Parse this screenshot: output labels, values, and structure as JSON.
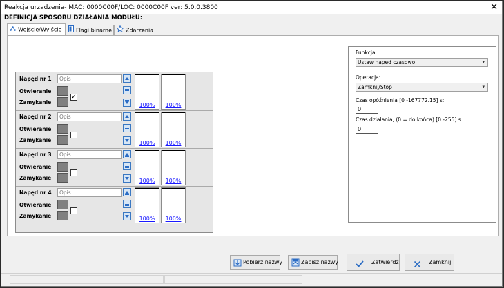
{
  "window": {
    "title": "Reakcja urzadzenia- MAC: 0000C00F/LOC: 0000C00F ver: 5.0.0.3800",
    "close_icon": "close-icon"
  },
  "heading": "DEFINICJA SPOSOBU DZIAŁANIA MODUŁU:",
  "tabs": [
    {
      "label": "Wejście/Wyjście",
      "icon": "network-icon",
      "active": true
    },
    {
      "label": "Flagi binarne",
      "icon": "flag-panel-icon",
      "active": false
    },
    {
      "label": "Zdarzenia",
      "icon": "star-icon",
      "active": false
    }
  ],
  "drives": [
    {
      "name": "Napęd nr 1",
      "opis": "Opis",
      "otwieranie": "Otwieranie",
      "zamykanie": "Zamykanie",
      "checked": true,
      "gauge1": "100%",
      "gauge2": "100%"
    },
    {
      "name": "Napęd nr 2",
      "opis": "Opis",
      "otwieranie": "Otwieranie",
      "zamykanie": "Zamykanie",
      "checked": false,
      "gauge1": "100%",
      "gauge2": "100%"
    },
    {
      "name": "Napęd nr 3",
      "opis": "Opis",
      "otwieranie": "Otwieranie",
      "zamykanie": "Zamykanie",
      "checked": false,
      "gauge1": "100%",
      "gauge2": "100%"
    },
    {
      "name": "Napęd nr 4",
      "opis": "Opis",
      "otwieranie": "Otwieranie",
      "zamykanie": "Zamykanie",
      "checked": false,
      "gauge1": "100%",
      "gauge2": "100%"
    }
  ],
  "settings": {
    "funkcja_label": "Funkcja:",
    "funkcja_value": "Ustaw napęd czasowo",
    "operacja_label": "Operacja:",
    "operacja_value": "Zamknij/Stop",
    "delay_label": "Czas opóźnienia [0 -167772.15] s:",
    "delay_value": "0",
    "duration_label": "Czas działania, (0 = do końca) [0 -255] s:",
    "duration_value": "0"
  },
  "buttons": {
    "pobierz": "Pobierz nazwy",
    "zapisz": "Zapisz nazwy",
    "zatwierdz": "Zatwierdź",
    "zamknij": "Zamknij"
  },
  "colors": {
    "accent": "#3a78c2",
    "link": "#1a1aff",
    "swatch": "#808080"
  }
}
